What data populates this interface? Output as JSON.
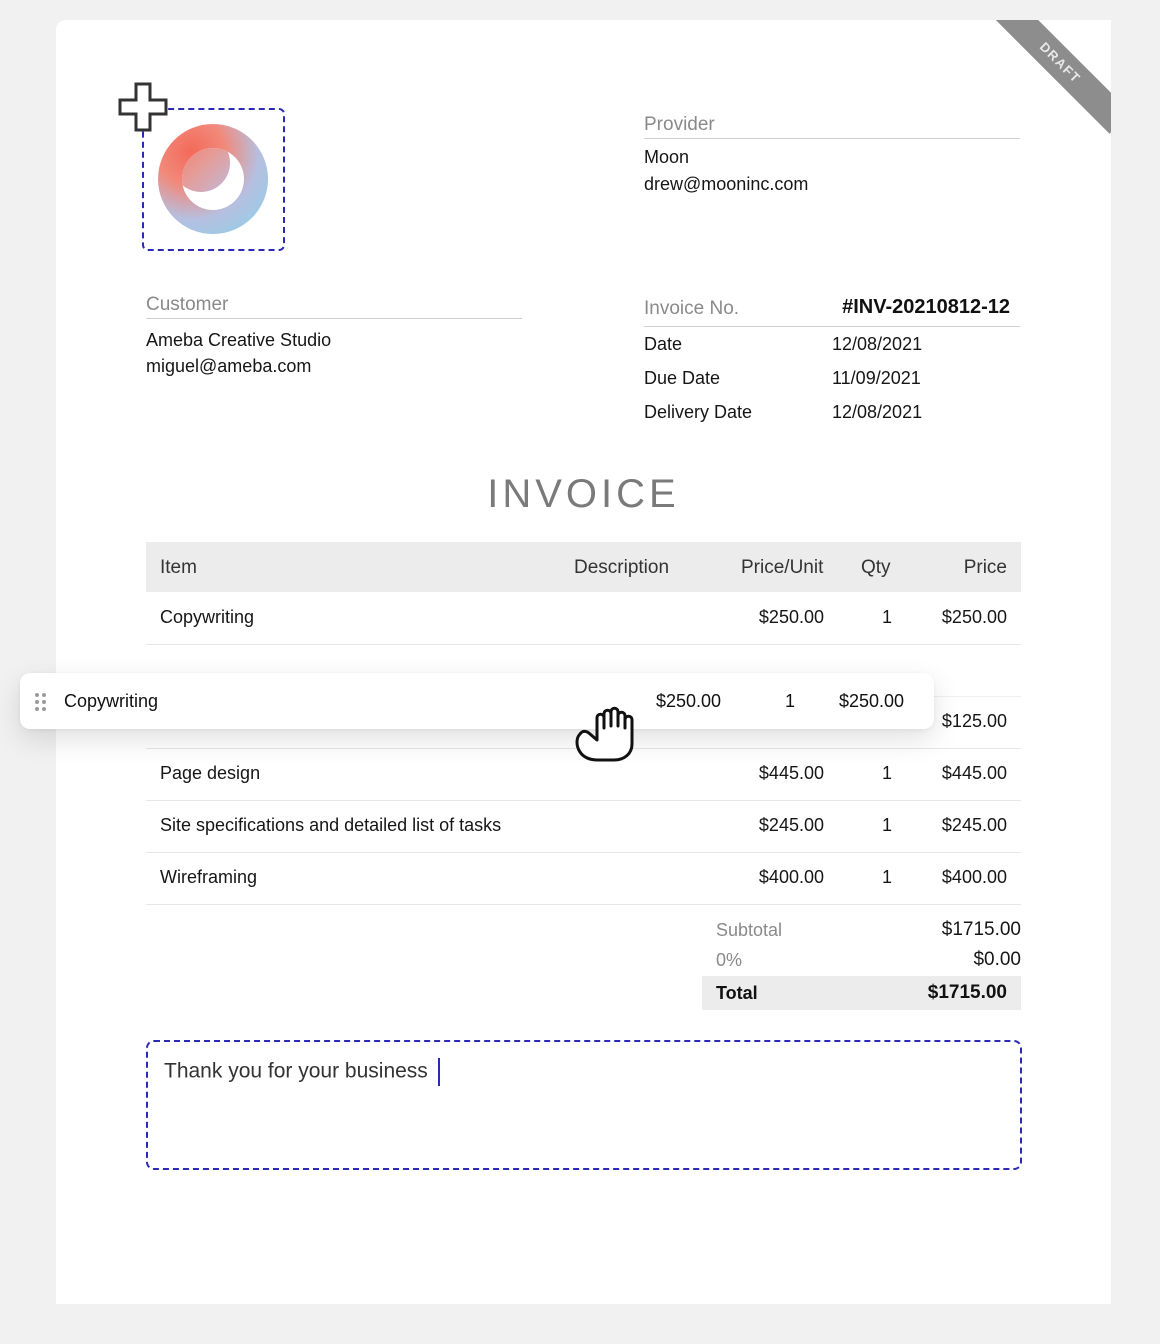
{
  "badge": "DRAFT",
  "provider": {
    "label": "Provider",
    "name": "Moon",
    "email": "drew@mooninc.com"
  },
  "customer": {
    "label": "Customer",
    "name": "Ameba Creative Studio",
    "email": "miguel@ameba.com"
  },
  "meta": {
    "invoice_no_label": "Invoice No.",
    "invoice_no": "#INV-20210812-12",
    "date_label": "Date",
    "date": "12/08/2021",
    "due_label": "Due Date",
    "due": "11/09/2021",
    "delivery_label": "Delivery Date",
    "delivery": "12/08/2021"
  },
  "title": "INVOICE",
  "table": {
    "headers": {
      "item": "Item",
      "description": "Description",
      "price_unit": "Price/Unit",
      "qty": "Qty",
      "price": "Price"
    },
    "rows": [
      {
        "item": "Copywriting",
        "price_unit": "$250.00",
        "qty": "1",
        "price": "$250.00"
      },
      {
        "item": "",
        "price_unit": "",
        "qty": "",
        "price": "$125.00"
      },
      {
        "item": "Page design",
        "price_unit": "$445.00",
        "qty": "1",
        "price": "$445.00"
      },
      {
        "item": "Site specifications and detailed list of tasks",
        "price_unit": "$245.00",
        "qty": "1",
        "price": "$245.00"
      },
      {
        "item": "Wireframing",
        "price_unit": "$400.00",
        "qty": "1",
        "price": "$400.00"
      }
    ]
  },
  "dragged_row": {
    "item": "Copywriting",
    "price_unit": "$250.00",
    "qty": "1",
    "price": "$250.00"
  },
  "totals": {
    "subtotal_label": "Subtotal",
    "subtotal": "$1715.00",
    "tax_label": "0%",
    "tax": "$0.00",
    "total_label": "Total",
    "total": "$1715.00"
  },
  "notes": {
    "text": "Thank you for your business"
  },
  "colors": {
    "accent": "#2a2ab5",
    "ribbon": "#8d8d8d",
    "header_bg": "#ececec"
  },
  "icons": {
    "add": "plus-icon",
    "drag": "grip-icon",
    "cursor": "grab-hand-icon"
  }
}
